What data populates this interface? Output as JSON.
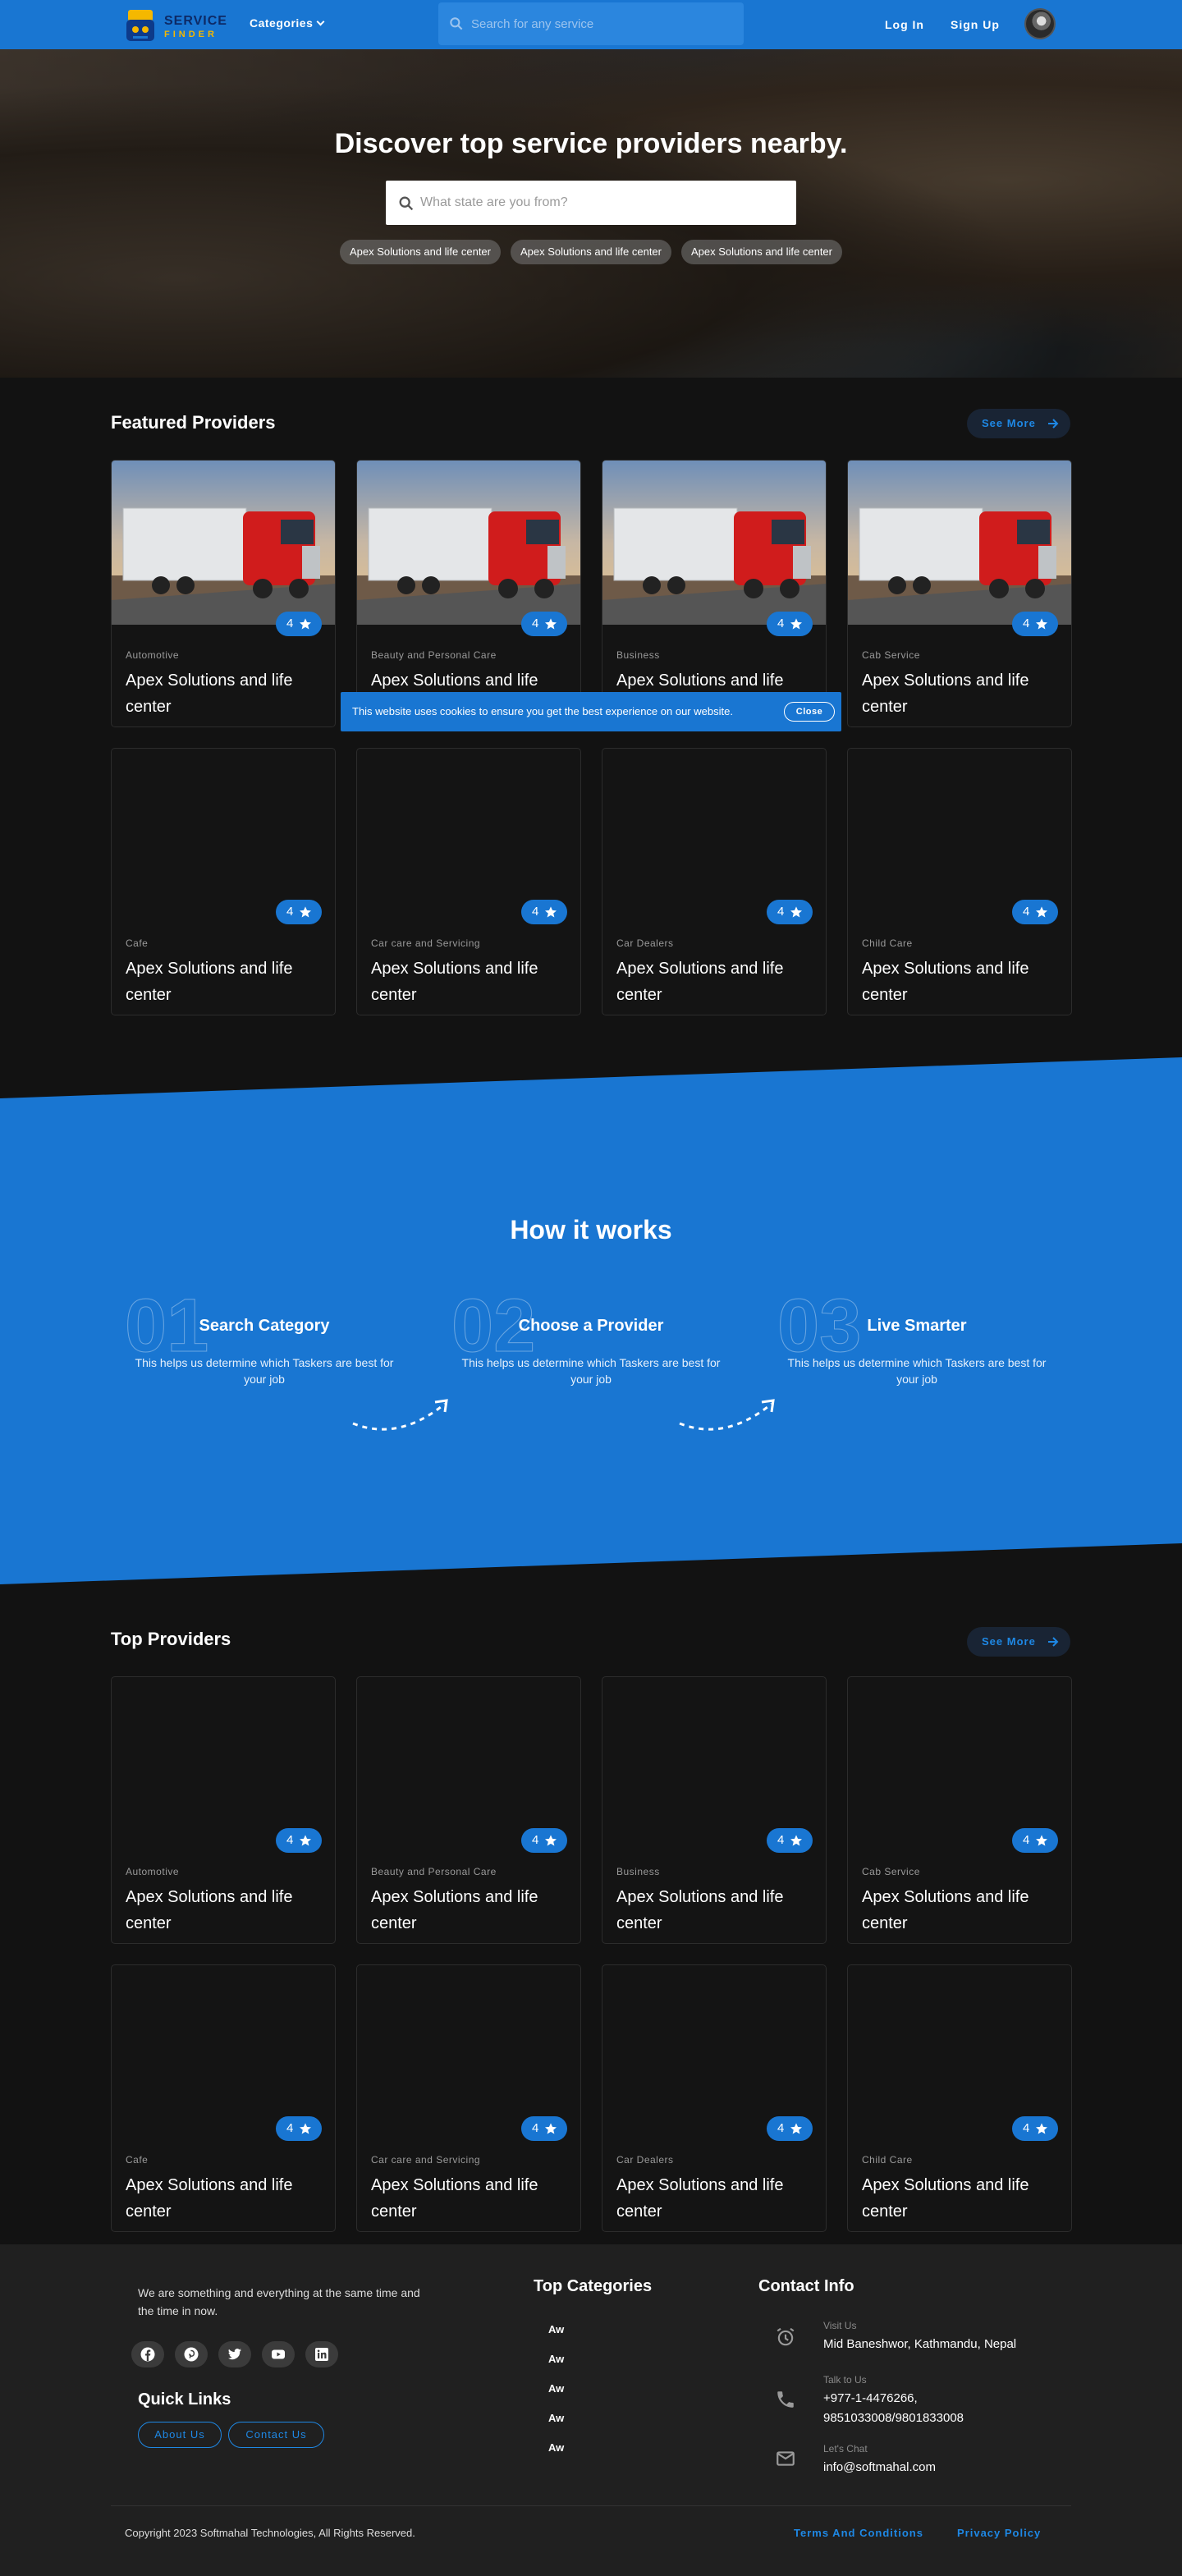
{
  "header": {
    "logo_line1": "SERVICE",
    "logo_line2": "FINDER",
    "categories_label": "Categories",
    "search_placeholder": "Search for any service",
    "login_label": "Log In",
    "signup_label": "Sign Up"
  },
  "hero": {
    "title": "Discover top service providers nearby.",
    "search_placeholder": "What state are you from?",
    "chips": [
      "Apex Solutions and life center",
      "Apex Solutions and life center",
      "Apex Solutions and life center"
    ]
  },
  "featured": {
    "title": "Featured Providers",
    "see_more": "See More",
    "cards": [
      {
        "category": "Automotive",
        "name": "Apex Solutions and life center",
        "rating": "4",
        "image": true
      },
      {
        "category": "Beauty and Personal Care",
        "name": "Apex Solutions and life center",
        "rating": "4",
        "image": true
      },
      {
        "category": "Business",
        "name": "Apex Solutions and life center",
        "rating": "4",
        "image": true
      },
      {
        "category": "Cab Service",
        "name": "Apex Solutions and life center",
        "rating": "4",
        "image": true
      },
      {
        "category": "Cafe",
        "name": "Apex Solutions and life center",
        "rating": "4",
        "image": false
      },
      {
        "category": "Car care and Servicing",
        "name": "Apex Solutions and life center",
        "rating": "4",
        "image": false
      },
      {
        "category": "Car Dealers",
        "name": "Apex Solutions and life center",
        "rating": "4",
        "image": false
      },
      {
        "category": "Child Care",
        "name": "Apex Solutions and life center",
        "rating": "4",
        "image": false
      }
    ]
  },
  "cookie": {
    "text": "This website uses cookies to ensure you get the best experience on our website.",
    "close_label": "Close"
  },
  "how": {
    "title": "How it works",
    "steps": [
      {
        "num": "01",
        "title": "Search Category",
        "desc": "This helps us determine which Taskers are best for your job"
      },
      {
        "num": "02",
        "title": "Choose a Provider",
        "desc": "This helps us determine which Taskers are best for your job"
      },
      {
        "num": "03",
        "title": "Live Smarter",
        "desc": "This helps us determine which Taskers are best for your job"
      }
    ]
  },
  "top": {
    "title": "Top Providers",
    "see_more": "See More",
    "cards": [
      {
        "category": "Automotive",
        "name": "Apex Solutions and life center",
        "rating": "4"
      },
      {
        "category": "Beauty and Personal Care",
        "name": "Apex Solutions and life center",
        "rating": "4"
      },
      {
        "category": "Business",
        "name": "Apex Solutions and life center",
        "rating": "4"
      },
      {
        "category": "Cab Service",
        "name": "Apex Solutions and life center",
        "rating": "4"
      },
      {
        "category": "Cafe",
        "name": "Apex Solutions and life center",
        "rating": "4"
      },
      {
        "category": "Car care and Servicing",
        "name": "Apex Solutions and life center",
        "rating": "4"
      },
      {
        "category": "Car Dealers",
        "name": "Apex Solutions and life center",
        "rating": "4"
      },
      {
        "category": "Child Care",
        "name": "Apex Solutions and life center",
        "rating": "4"
      }
    ]
  },
  "footer": {
    "about": "We are something and everything at the same time and the time in now.",
    "socials": [
      "facebook-icon",
      "pinterest-icon",
      "twitter-icon",
      "youtube-icon",
      "linkedin-icon"
    ],
    "quick_links_title": "Quick Links",
    "about_us": "About Us",
    "contact_us": "Contact Us",
    "top_categories_title": "Top Categories",
    "top_categories": [
      "Aw",
      "Aw",
      "Aw",
      "Aw",
      "Aw"
    ],
    "contact_title": "Contact Info",
    "visit_label": "Visit Us",
    "visit_value": "Mid Baneshwor, Kathmandu, Nepal",
    "talk_label": "Talk to Us",
    "talk_value_1": "+977-1-4476266,",
    "talk_value_2": "9851033008/9801833008",
    "chat_label": "Let's Chat",
    "chat_value": "info@softmahal.com",
    "copyright": "Copyright 2023 Softmahal Technologies, All Rights Reserved.",
    "terms": "Terms And Conditions",
    "privacy": "Privacy Policy"
  },
  "colors": {
    "primary": "#1976d2",
    "background": "#121212",
    "card": "#141414",
    "footer": "#202020"
  }
}
